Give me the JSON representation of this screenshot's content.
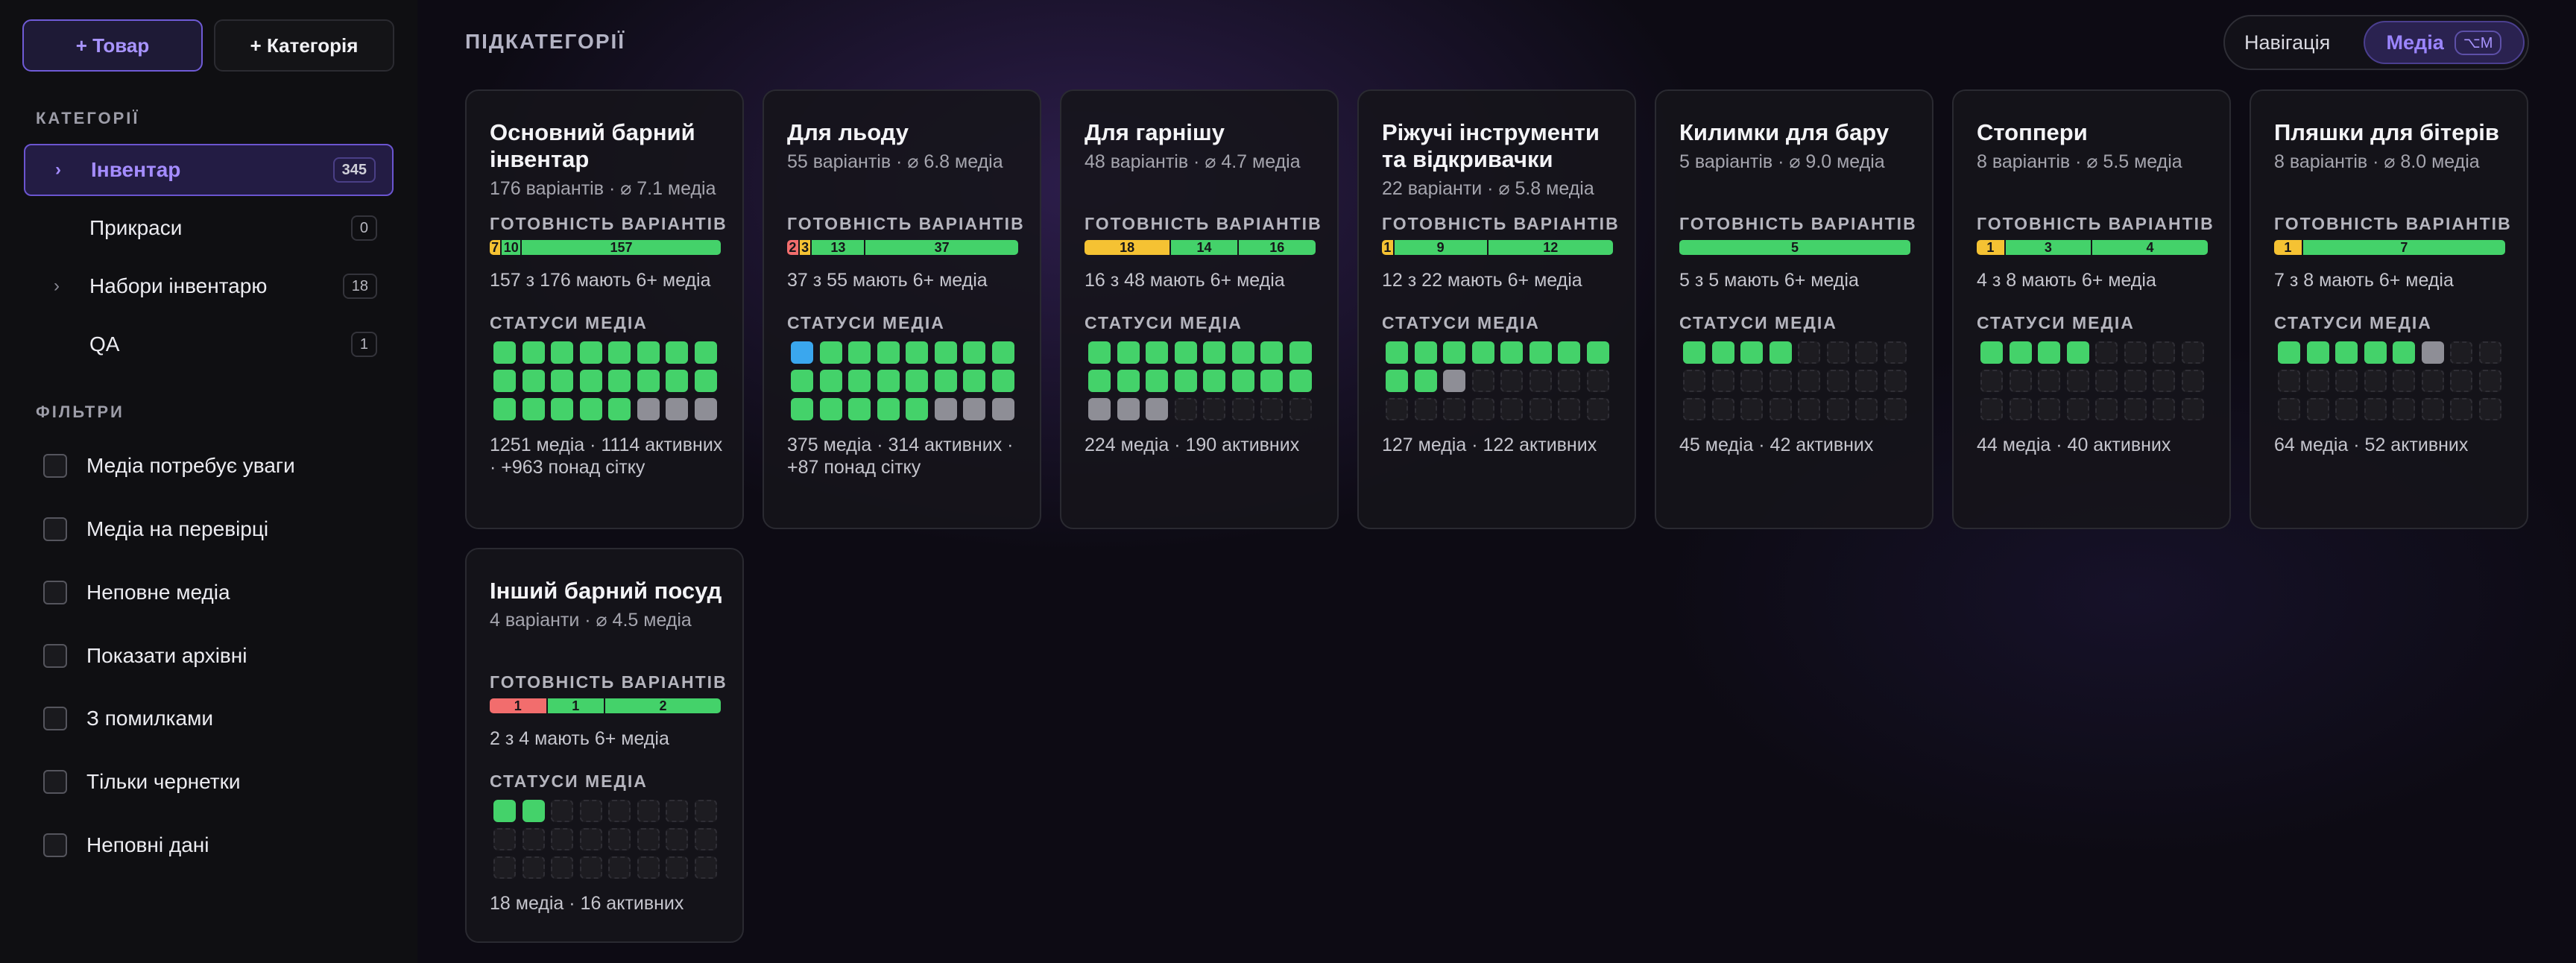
{
  "sidebar": {
    "add_product": "+ Товар",
    "add_category": "+ Категорія",
    "categories_title": "КАТЕГОРІЇ",
    "categories": [
      {
        "label": "Інвентар",
        "count": "345",
        "chevron": "›"
      },
      {
        "label": "Прикраси",
        "count": "0"
      },
      {
        "label": "Набори інвентарю",
        "count": "18",
        "chevron": "›"
      },
      {
        "label": "QA",
        "count": "1"
      }
    ],
    "filters_title": "ФІЛЬТРИ",
    "filters": [
      "Медіа потребує уваги",
      "Медіа на перевірці",
      "Неповне медіа",
      "Показати архівні",
      "З помилками",
      "Тільки чернетки",
      "Неповні дані"
    ]
  },
  "main": {
    "title": "ПІДКАТЕГОРІЇ",
    "toggle": {
      "nav": "Навігація",
      "media": "Медіа",
      "shortcut": "⌥M"
    },
    "readiness_label": "ГОТОВНІСТЬ ВАРІАНТІВ",
    "media_status_label": "СТАТУСИ МЕДІА",
    "cards": [
      {
        "name": "Основний барний інвентар",
        "meta": "176 варіантів · ⌀ 7.1 медіа",
        "segments": [
          {
            "c": "yellow",
            "v": "7"
          },
          {
            "c": "green",
            "v": "10"
          },
          {
            "c": "green",
            "v": "157"
          }
        ],
        "ready": "157 з 176 мають 6+ медіа",
        "cells": "gggggggg gggggggg gggggsss",
        "media": "1251 медіа · 1114 активних · +963 понад сітку"
      },
      {
        "name": "Для льоду",
        "meta": "55 варіантів · ⌀ 6.8 медіа",
        "segments": [
          {
            "c": "red",
            "v": "2"
          },
          {
            "c": "yellow",
            "v": "3"
          },
          {
            "c": "green",
            "v": "13"
          },
          {
            "c": "green",
            "v": "37"
          }
        ],
        "ready": "37 з 55 мають 6+ медіа",
        "cells": "bggggggg gggggggg gggggsss",
        "media": "375 медіа · 314 активних · +87 понад сітку"
      },
      {
        "name": "Для гарнішу",
        "meta": "48 варіантів · ⌀ 4.7 медіа",
        "segments": [
          {
            "c": "yellow",
            "v": "18"
          },
          {
            "c": "green",
            "v": "14"
          },
          {
            "c": "green",
            "v": "16"
          }
        ],
        "ready": "16 з 48 мають 6+ медіа",
        "cells": "gggggggg gggggggg ssseeeee",
        "media": "224 медіа · 190 активних"
      },
      {
        "name": "Ріжучі інструменти та відкривачки",
        "meta": "22 варіанти · ⌀ 5.8 медіа",
        "segments": [
          {
            "c": "yellow",
            "v": "1"
          },
          {
            "c": "green",
            "v": "9"
          },
          {
            "c": "green",
            "v": "12"
          }
        ],
        "ready": "12 з 22 мають 6+ медіа",
        "cells": "gggggggg ggseeeee eeeeeeee",
        "media": "127 медіа · 122 активних"
      },
      {
        "name": "Килимки для бару",
        "meta": "5 варіантів · ⌀ 9.0 медіа",
        "segments": [
          {
            "c": "green",
            "v": "5"
          }
        ],
        "ready": "5 з 5 мають 6+ медіа",
        "cells": "ggggeeee eeeeeeee eeeeeeee",
        "media": "45 медіа · 42 активних"
      },
      {
        "name": "Стоппери",
        "meta": "8 варіантів · ⌀ 5.5 медіа",
        "segments": [
          {
            "c": "yellow",
            "v": "1"
          },
          {
            "c": "green",
            "v": "3"
          },
          {
            "c": "green",
            "v": "4"
          }
        ],
        "ready": "4 з 8 мають 6+ медіа",
        "cells": "ggggeeee eeeeeeee eeeeeeee",
        "media": "44 медіа · 40 активних"
      },
      {
        "name": "Пляшки для бітерів",
        "meta": "8 варіантів · ⌀ 8.0 медіа",
        "segments": [
          {
            "c": "yellow",
            "v": "1"
          },
          {
            "c": "green",
            "v": "7"
          }
        ],
        "ready": "7 з 8 мають 6+ медіа",
        "cells": "gggggsee eeeeeeee eeeeeeee",
        "media": "64 медіа · 52 активних"
      },
      {
        "name": "Інший барний посуд",
        "meta": "4 варіанти · ⌀ 4.5 медіа",
        "segments": [
          {
            "c": "red",
            "v": "1"
          },
          {
            "c": "green",
            "v": "1"
          },
          {
            "c": "green",
            "v": "2"
          }
        ],
        "ready": "2 з 4 мають 6+ медіа",
        "cells": "ggeeeeee eeeeeeee eeeeeeee",
        "media": "18 медіа · 16 активних"
      }
    ]
  },
  "colors": {
    "accent": "#8b6cff",
    "segment_red": "#f26d6d",
    "segment_yellow": "#f5c233",
    "segment_green": "#44d26a",
    "media_active": "#44d26a",
    "media_blue": "#3aa7ee",
    "media_grey": "#8e8e96"
  }
}
